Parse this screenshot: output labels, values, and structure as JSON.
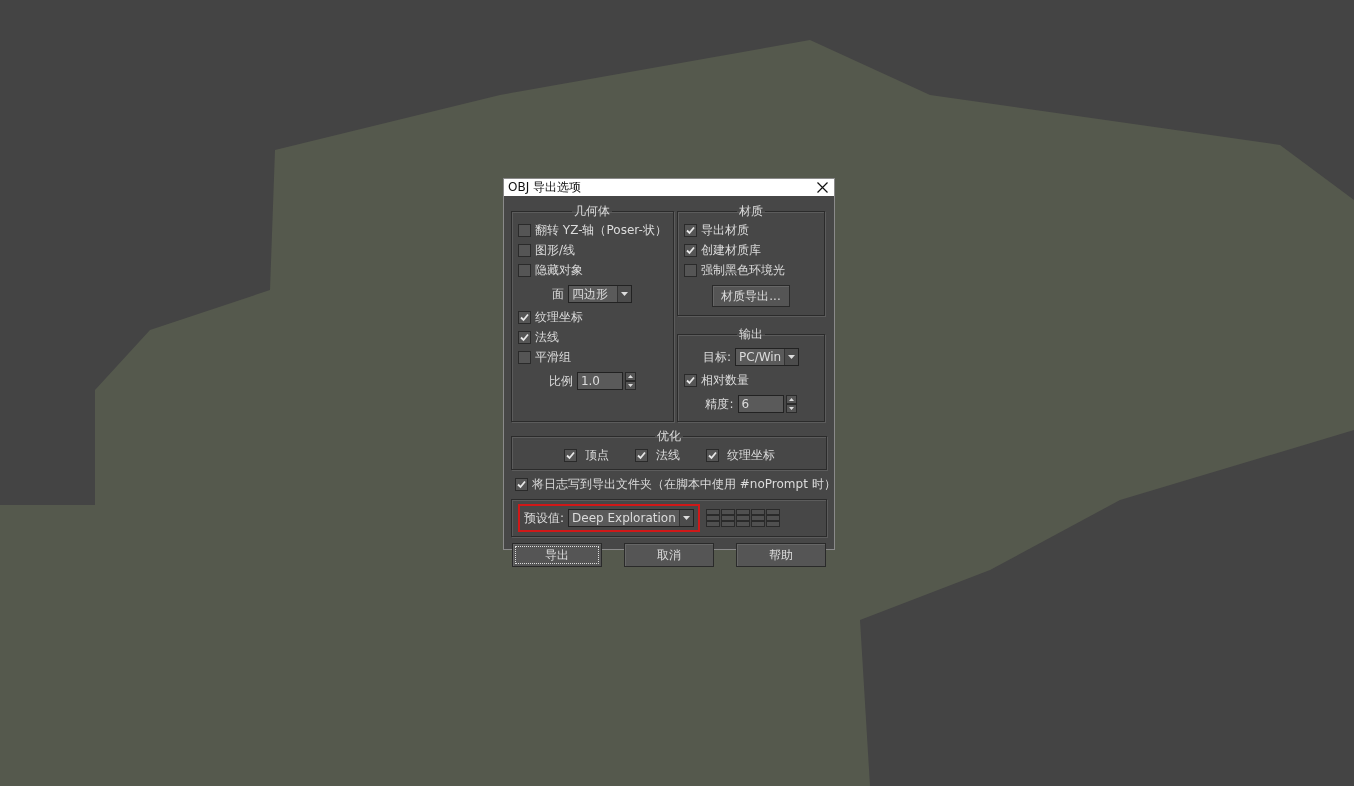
{
  "window": {
    "title": "OBJ 导出选项"
  },
  "geometry": {
    "title": "几何体",
    "items": [
      {
        "kind": "checkbox",
        "label": "翻转 YZ-轴（Poser-状）",
        "checked": false
      },
      {
        "kind": "checkbox",
        "label": "图形/线",
        "checked": false
      },
      {
        "kind": "checkbox",
        "label": "隐藏对象",
        "checked": false
      },
      {
        "kind": "dropdown",
        "label": "面",
        "value": "四边形"
      },
      {
        "kind": "checkbox",
        "label": "纹理坐标",
        "checked": true
      },
      {
        "kind": "checkbox",
        "label": "法线",
        "checked": true
      },
      {
        "kind": "checkbox",
        "label": "平滑组",
        "checked": false
      },
      {
        "kind": "spinner",
        "label": "比例",
        "value": "1.0"
      }
    ]
  },
  "material": {
    "title": "材质",
    "items": [
      {
        "kind": "checkbox",
        "label": "导出材质",
        "checked": true
      },
      {
        "kind": "checkbox",
        "label": "创建材质库",
        "checked": true
      },
      {
        "kind": "checkbox",
        "label": "强制黑色环境光",
        "checked": false
      },
      {
        "kind": "button",
        "label": "材质导出..."
      }
    ]
  },
  "output": {
    "title": "输出",
    "items": [
      {
        "kind": "dropdown",
        "label": "目标:",
        "value": "PC/Win"
      },
      {
        "kind": "checkbox",
        "label": "相对数量",
        "checked": true
      },
      {
        "kind": "spinner",
        "label": "精度:",
        "value": "6"
      }
    ]
  },
  "optimize": {
    "title": "优化",
    "items": [
      {
        "kind": "checkbox",
        "label": "顶点",
        "checked": true
      },
      {
        "kind": "checkbox",
        "label": "法线",
        "checked": true
      },
      {
        "kind": "checkbox",
        "label": "纹理坐标",
        "checked": true
      }
    ]
  },
  "log": {
    "kind": "checkbox",
    "label": "将日志写到导出文件夹（在脚本中使用 #noPrompt 时）",
    "checked": true
  },
  "preset": {
    "label": "预设值:",
    "value": "Deep Exploration",
    "highlighted": true
  },
  "buttons": [
    {
      "label": "导出",
      "focused": true
    },
    {
      "label": "取消",
      "focused": false
    },
    {
      "label": "帮助",
      "focused": false
    }
  ]
}
